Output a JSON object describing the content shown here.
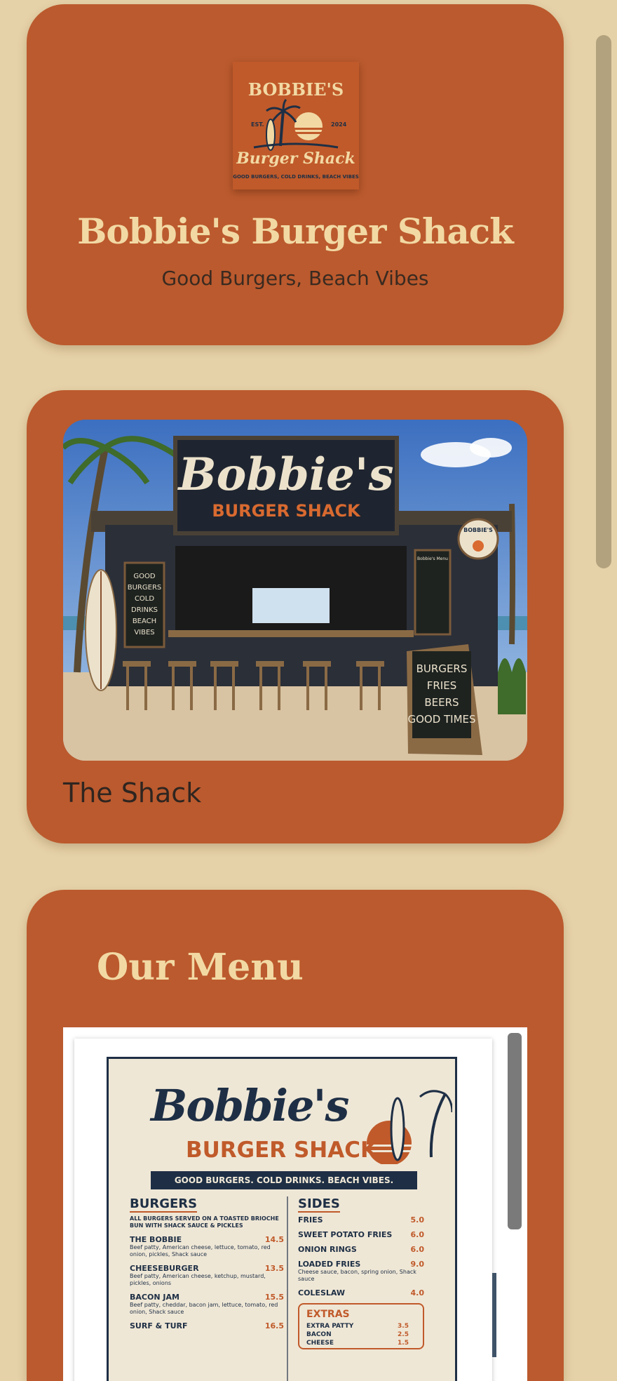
{
  "header": {
    "title": "Bobbie's Burger Shack",
    "tagline": "Good Burgers, Beach Vibes",
    "logo": {
      "name": "BOBBIE'S",
      "script": "Burger Shack",
      "est": "EST.",
      "year": "2024",
      "arc_text": "GOOD BURGERS, COLD DRINKS, BEACH VIBES"
    }
  },
  "shack": {
    "caption": "The Shack",
    "photo": {
      "sign_script": "Bobbie's",
      "sign_sub": "BURGER SHACK",
      "chalkboard_left": [
        "GOOD",
        "BURGERS",
        "COLD",
        "DRINKS",
        "BEACH",
        "VIBES"
      ],
      "sandwich_board": [
        "BURGERS",
        "FRIES",
        "BEERS",
        "GOOD TIMES"
      ],
      "menu_board_title": "Bobbie's Menu",
      "round_sign": "BOBBIE'S"
    }
  },
  "menu": {
    "heading": "Our Menu",
    "doc": {
      "title_script": "Bobbie's",
      "title_sub": "BURGER SHACK",
      "strap": "GOOD BURGERS. COLD DRINKS. BEACH VIBES.",
      "burgers": {
        "heading": "BURGERS",
        "note": "ALL BURGERS SERVED ON A TOASTED BRIOCHE BUN WITH SHACK SAUCE & PICKLES",
        "items": [
          {
            "name": "THE BOBBIE",
            "price": "14.5",
            "desc": "Beef patty, American cheese, lettuce, tomato, red onion, pickles, Shack sauce"
          },
          {
            "name": "CHEESEBURGER",
            "price": "13.5",
            "desc": "Beef patty, American cheese, ketchup, mustard, pickles, onions"
          },
          {
            "name": "BACON JAM",
            "price": "15.5",
            "desc": "Beef patty, cheddar, bacon jam, lettuce, tomato, red onion, Shack sauce"
          },
          {
            "name": "SURF & TURF",
            "price": "16.5",
            "desc": ""
          }
        ]
      },
      "sides": {
        "heading": "SIDES",
        "items": [
          {
            "name": "FRIES",
            "price": "5.0",
            "desc": ""
          },
          {
            "name": "SWEET POTATO FRIES",
            "price": "6.0",
            "desc": ""
          },
          {
            "name": "ONION RINGS",
            "price": "6.0",
            "desc": ""
          },
          {
            "name": "LOADED FRIES",
            "price": "9.0",
            "desc": "Cheese sauce, bacon, spring onion, Shack sauce"
          },
          {
            "name": "COLESLAW",
            "price": "4.0",
            "desc": ""
          }
        ]
      },
      "extras": {
        "heading": "EXTRAS",
        "items": [
          {
            "name": "EXTRA PATTY",
            "price": "3.5"
          },
          {
            "name": "BACON",
            "price": "2.5"
          },
          {
            "name": "CHEESE",
            "price": "1.5"
          }
        ]
      }
    }
  },
  "colors": {
    "page_bg": "#e6d2a8",
    "card_bg": "#bb5a2e",
    "title_cream": "#f2d9a4",
    "navy": "#1e2f45"
  }
}
